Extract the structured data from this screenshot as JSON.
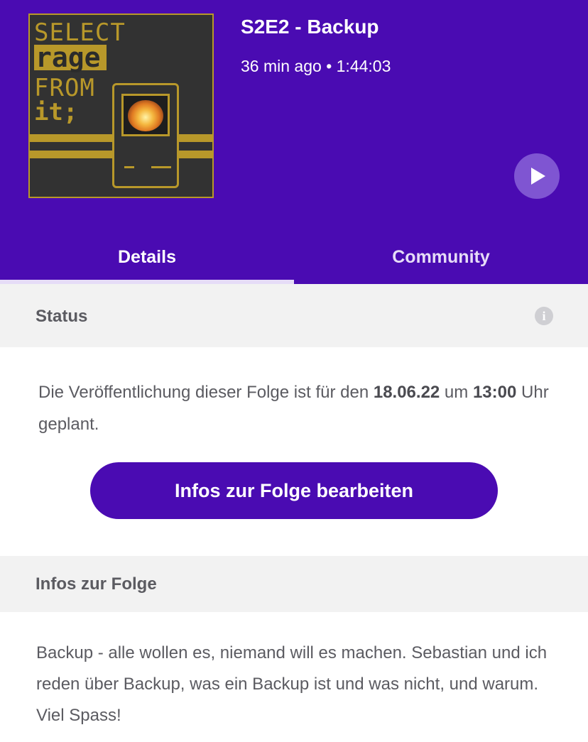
{
  "episode": {
    "cover": {
      "line1": "SELECT",
      "line2": "rage",
      "line3": "FROM",
      "line4": "it;"
    },
    "title": "S2E2 - Backup",
    "meta": "36 min ago • 1:44:03",
    "play_icon": "play-icon"
  },
  "tabs": [
    {
      "label": "Details",
      "active": true
    },
    {
      "label": "Community",
      "active": false
    }
  ],
  "status_section": {
    "heading": "Status",
    "info_icon": "info-icon",
    "text_before": "Die Veröffentlichung dieser Folge ist für den ",
    "date": "18.06.22",
    "text_mid": " um ",
    "time": "13:00",
    "text_after": " Uhr geplant.",
    "edit_button": "Infos zur Folge bearbeiten"
  },
  "info_section": {
    "heading": "Infos zur Folge",
    "description": "Backup - alle wollen es, niemand will es machen. Sebastian und ich reden über Backup, was ein Backup ist und was nicht, und warum. Viel Spass!"
  },
  "colors": {
    "brand_purple": "#4a0bb2",
    "cover_gold": "#b8982a"
  }
}
